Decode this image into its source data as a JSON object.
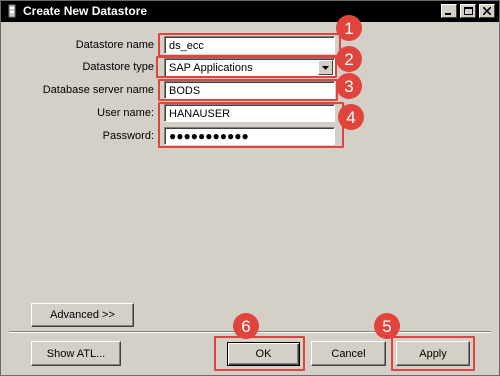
{
  "window": {
    "title": "Create New Datastore"
  },
  "form": {
    "datastore_name": {
      "label": "Datastore name",
      "value": "ds_ecc"
    },
    "datastore_type": {
      "label": "Datastore type",
      "value": "SAP Applications"
    },
    "db_server": {
      "label": "Database server name",
      "value": "BODS"
    },
    "user_name": {
      "label": "User name:",
      "value": "HANAUSER"
    },
    "password": {
      "label": "Password:",
      "value": "●●●●●●●●●●●"
    }
  },
  "buttons": {
    "advanced": "Advanced >>",
    "show_atl": "Show ATL...",
    "ok": "OK",
    "cancel": "Cancel",
    "apply": "Apply"
  },
  "annotations": [
    "1",
    "2",
    "3",
    "4",
    "5",
    "6"
  ],
  "colors": {
    "annotation": "#e0443c",
    "dialog_bg": "#d4d0c8",
    "titlebar": "#000000"
  },
  "icons": {
    "app": "datastore-app-icon",
    "minimize": "minimize-icon",
    "maximize": "maximize-icon",
    "close": "close-icon",
    "dropdown": "chevron-down-icon"
  }
}
